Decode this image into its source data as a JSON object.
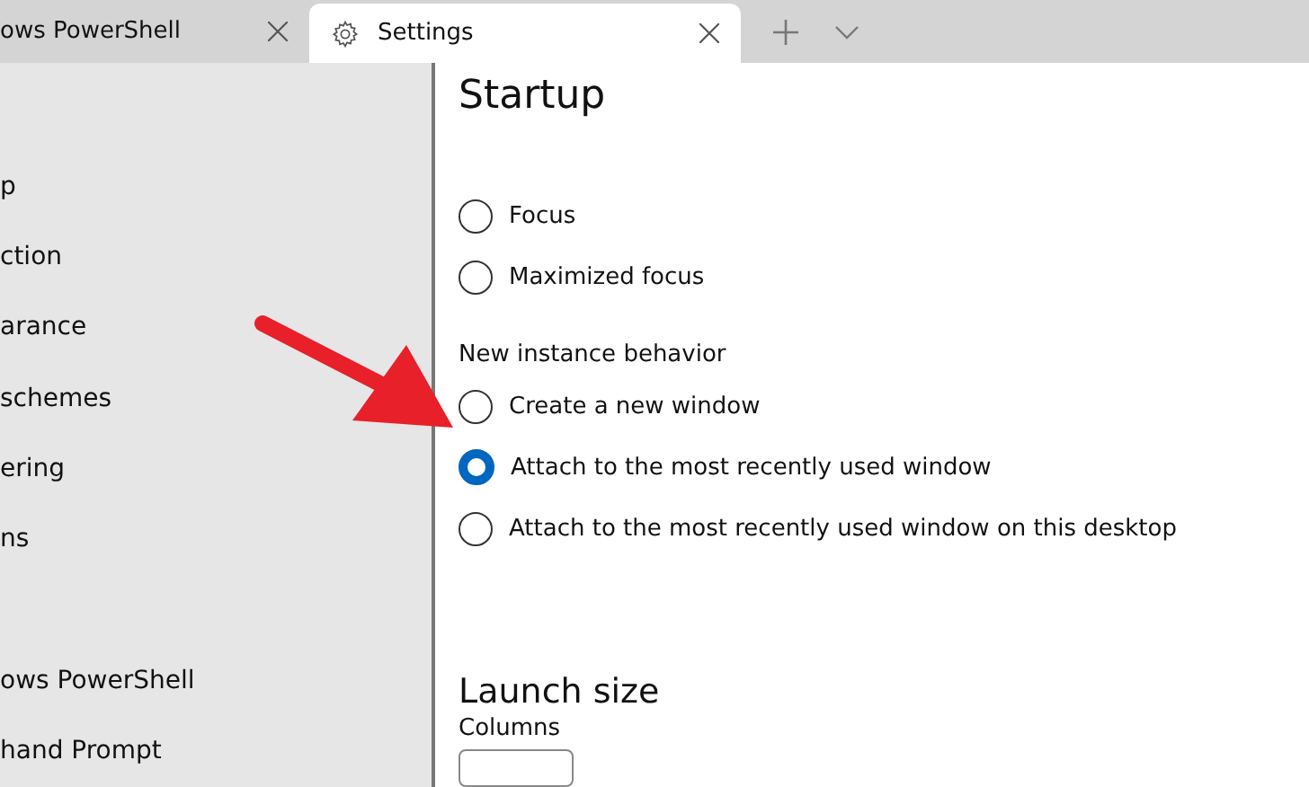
{
  "tabs": [
    {
      "label": "ows PowerShell",
      "selected": false
    },
    {
      "label": "Settings",
      "selected": true
    }
  ],
  "sidebar": {
    "items": [
      {
        "label": "p"
      },
      {
        "label": "ction"
      },
      {
        "label": "arance"
      },
      {
        "label": "schemes"
      },
      {
        "label": "ering"
      },
      {
        "label": "ns"
      }
    ],
    "profiles": [
      {
        "label": "ows PowerShell"
      },
      {
        "label": "hand Prompt"
      }
    ]
  },
  "content": {
    "title": "Startup",
    "launch_mode": [
      {
        "label": "Focus",
        "selected": false
      },
      {
        "label": "Maximized focus",
        "selected": false
      }
    ],
    "new_instance": {
      "label": "New instance behavior",
      "options": [
        {
          "label": "Create a new window",
          "selected": false
        },
        {
          "label": "Attach to the most recently used window",
          "selected": true
        },
        {
          "label": "Attach to the most recently used window on this desktop",
          "selected": false
        }
      ]
    },
    "launch_size": {
      "title": "Launch size",
      "columns_label": "Columns"
    }
  }
}
